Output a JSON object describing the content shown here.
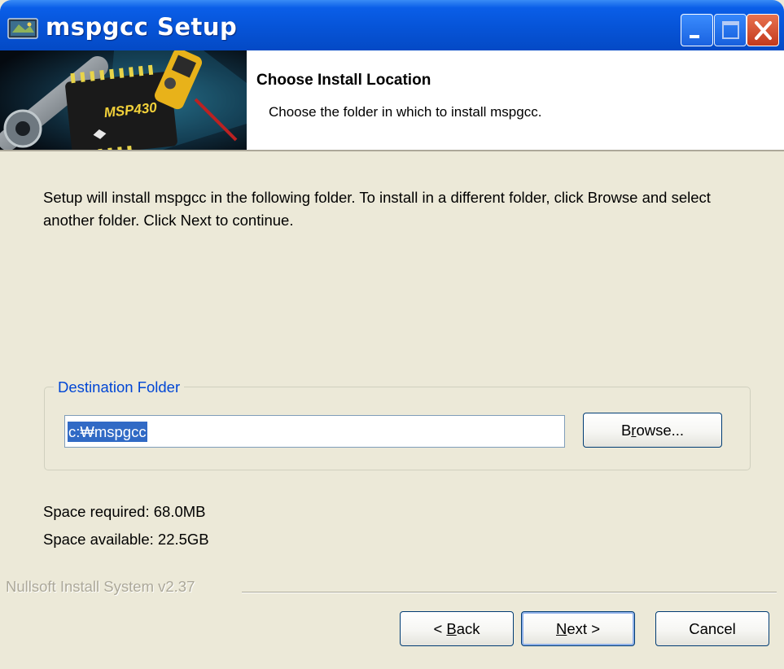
{
  "window": {
    "title": "mspgcc Setup"
  },
  "titlebar_buttons": {
    "minimize": "minimize-icon",
    "maximize": "maximize-icon",
    "close": "close-icon"
  },
  "header": {
    "title": "Choose Install Location",
    "subtitle": "Choose the folder in which to install mspgcc.",
    "banner": {
      "chip_text": "MSP430"
    }
  },
  "intro_text": "Setup will install mspgcc in the following folder. To install in a different folder, click Browse and select another folder. Click Next to continue.",
  "destination": {
    "group_label": "Destination Folder",
    "path_value": "c:₩mspgcc",
    "browse_label_prefix": "B",
    "browse_label_accel": "r",
    "browse_label_suffix": "owse..."
  },
  "space": {
    "required": "Space required: 68.0MB",
    "available": "Space available: 22.5GB"
  },
  "branding": "Nullsoft Install System v2.37",
  "buttons": {
    "back_prefix": "< ",
    "back_accel": "B",
    "back_suffix": "ack",
    "next_accel": "N",
    "next_suffix": "ext >",
    "cancel": "Cancel"
  },
  "colors": {
    "titlebar": "#0653d6",
    "dialog_bg": "#ece9d8",
    "group_label": "#0046d5",
    "selection": "#316ac5",
    "disabled_text": "#aca899"
  }
}
